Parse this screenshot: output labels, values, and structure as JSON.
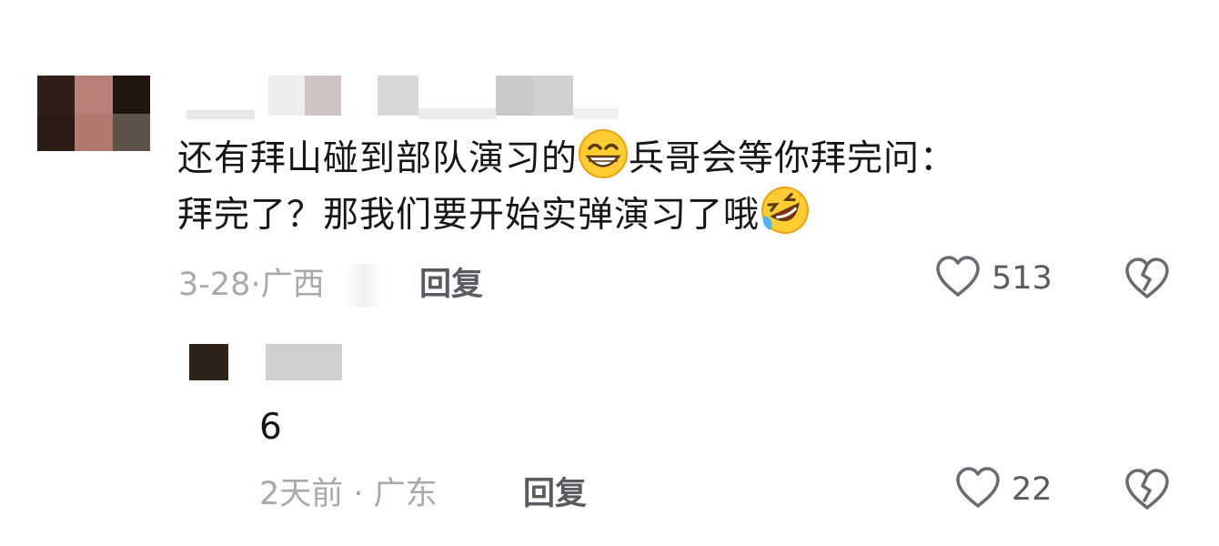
{
  "comment": {
    "text_line1": "还有拜山碰到部队演习的",
    "emoji1": "grinning-face-emoji",
    "text_line1_end": "兵哥会等你拜完问：",
    "text_line2": "拜完了？那我们要开始实弹演习了哦",
    "emoji2": "rolling-on-floor-laughing-emoji",
    "date": "3-28",
    "location": "广西",
    "reply_label": "回复",
    "likes": "513"
  },
  "reply": {
    "text": "6",
    "date": "2天前",
    "location": "广东",
    "reply_label": "回复",
    "likes": "22"
  },
  "colors": {
    "heart_outline": "#6a6a70",
    "meta_text": "#a9a9ad",
    "body_text": "#161616"
  }
}
